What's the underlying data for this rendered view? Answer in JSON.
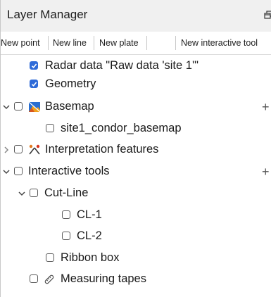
{
  "panel": {
    "title": "Layer Manager"
  },
  "toolbar": {
    "new_point": "New point",
    "new_line": "New line",
    "new_plate": "New plate",
    "new_interactive_tool": "New interactive tool"
  },
  "tree": {
    "radar_data": {
      "label": "Radar data \"Raw data 'site 1'\"",
      "checked": true
    },
    "geometry": {
      "label": "Geometry",
      "checked": true
    },
    "basemap": {
      "label": "Basemap",
      "checked": false,
      "expanded": true,
      "icon": "basemap-map-icon",
      "add_label": "+"
    },
    "site1_basemap": {
      "label": "site1_condor_basemap",
      "checked": false
    },
    "interpretation": {
      "label": "Interpretation features",
      "checked": false,
      "expanded": false,
      "icon": "interpretation-features-icon"
    },
    "interactive_tools": {
      "label": "Interactive tools",
      "checked": false,
      "expanded": true,
      "add_label": "+"
    },
    "cut_line": {
      "label": "Cut-Line",
      "checked": false,
      "expanded": true
    },
    "cl1": {
      "label": "CL-1",
      "checked": false
    },
    "cl2": {
      "label": "CL-2",
      "checked": false
    },
    "ribbon_box": {
      "label": "Ribbon box",
      "checked": false
    },
    "measuring_tapes": {
      "label": "Measuring tapes",
      "checked": false,
      "icon": "measuring-tape-icon"
    }
  },
  "colors": {
    "checkbox_checked": "#2f6bd8",
    "titlebar_bg": "#f0f0f0"
  }
}
